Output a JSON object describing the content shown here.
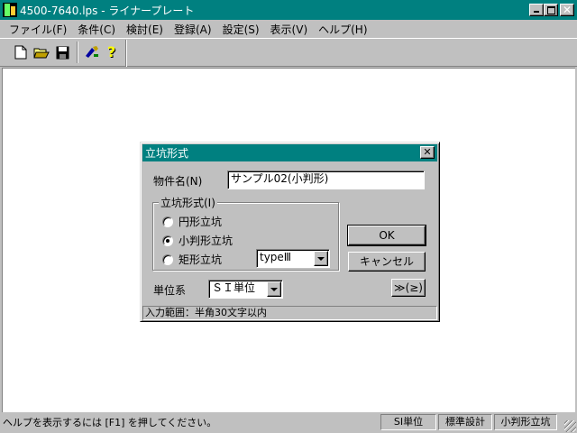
{
  "window": {
    "title": "4500-7640.lps - ライナープレート",
    "accent_color": "#008080",
    "minimize_icon": "minimize-icon",
    "maximize_icon": "maximize-icon",
    "close_glyph": "✕"
  },
  "menu": [
    {
      "label": "ファイル(F)"
    },
    {
      "label": "条件(C)"
    },
    {
      "label": "検討(E)"
    },
    {
      "label": "登録(A)"
    },
    {
      "label": "設定(S)"
    },
    {
      "label": "表示(V)"
    },
    {
      "label": "ヘルプ(H)"
    }
  ],
  "toolbar": {
    "icons": [
      "new-file-icon",
      "open-folder-icon",
      "save-disk-icon",
      "run-tool-icon",
      "help-question-icon"
    ]
  },
  "dialog": {
    "title": "立坑形式",
    "close_glyph": "✕",
    "object_name_label": "物件名(N)",
    "object_name_value": "サンプル02(小判形)",
    "shaft_group_label": "立坑形式(I)",
    "options": [
      {
        "label": "円形立坑",
        "checked": false
      },
      {
        "label": "小判形立坑",
        "checked": true
      },
      {
        "label": "矩形立坑",
        "checked": false
      }
    ],
    "type_select_value": "typeⅢ",
    "unit_label": "単位系",
    "unit_select_value": "ＳＩ単位",
    "ok_label": "OK",
    "cancel_label": "キャンセル",
    "more_label": "≫(≥)",
    "status_text": "入力範囲：半角30文字以内"
  },
  "statusbar": {
    "help_text": "ヘルプを表示するには [F1] を押してください。",
    "panels": [
      "SI単位",
      "標準設計",
      "小判形立坑"
    ]
  }
}
